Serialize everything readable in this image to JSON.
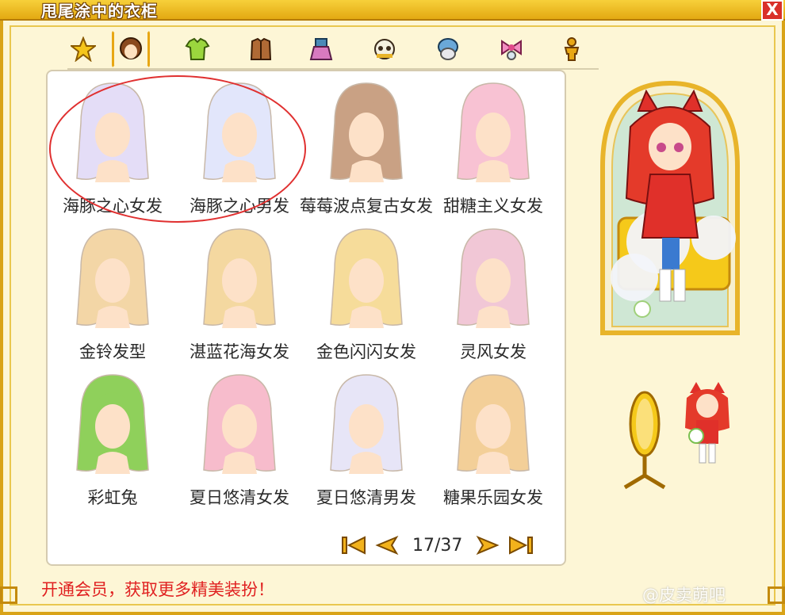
{
  "window": {
    "title": "甩尾涂中的衣柜",
    "close_label": "X"
  },
  "tabs": [
    {
      "id": "favorites",
      "icon": "star-icon",
      "active": false
    },
    {
      "id": "hair",
      "icon": "hair-icon",
      "active": true
    },
    {
      "id": "top",
      "icon": "shirt-icon",
      "active": false
    },
    {
      "id": "outfit",
      "icon": "coat-icon",
      "active": false
    },
    {
      "id": "bottom",
      "icon": "skirt-icon",
      "active": false
    },
    {
      "id": "face",
      "icon": "face-icon",
      "active": false
    },
    {
      "id": "hat",
      "icon": "hat-icon",
      "active": false
    },
    {
      "id": "accessory",
      "icon": "bow-icon",
      "active": false
    },
    {
      "id": "pose",
      "icon": "figure-icon",
      "active": false
    }
  ],
  "items": [
    {
      "name": "海豚之心女发",
      "color": "#e4ddf7"
    },
    {
      "name": "海豚之心男发",
      "color": "#e2e6fb"
    },
    {
      "name": "莓莓波点复古女发",
      "color": "#c9a184"
    },
    {
      "name": "甜糖主义女发",
      "color": "#f8c2d3"
    },
    {
      "name": "金铃发型",
      "color": "#f3d6a6"
    },
    {
      "name": "湛蓝花海女发",
      "color": "#f4d8a0"
    },
    {
      "name": "金色闪闪女发",
      "color": "#f6dc9a"
    },
    {
      "name": "灵风女发",
      "color": "#f1c7d6"
    },
    {
      "name": "彩虹兔",
      "color": "#8fd05b"
    },
    {
      "name": "夏日悠清女发",
      "color": "#f7bccc"
    },
    {
      "name": "夏日悠清男发",
      "color": "#e7e5f7"
    },
    {
      "name": "糖果乐园女发",
      "color": "#f3cf98"
    }
  ],
  "pager": {
    "current": "17/37"
  },
  "vip_text": "开通会员，获取更多精美装扮！",
  "watermark": "@皮卖萌吧",
  "colors": {
    "frame": "#d9a318",
    "accent": "#e8a714",
    "highlight_circle": "#e03030"
  }
}
